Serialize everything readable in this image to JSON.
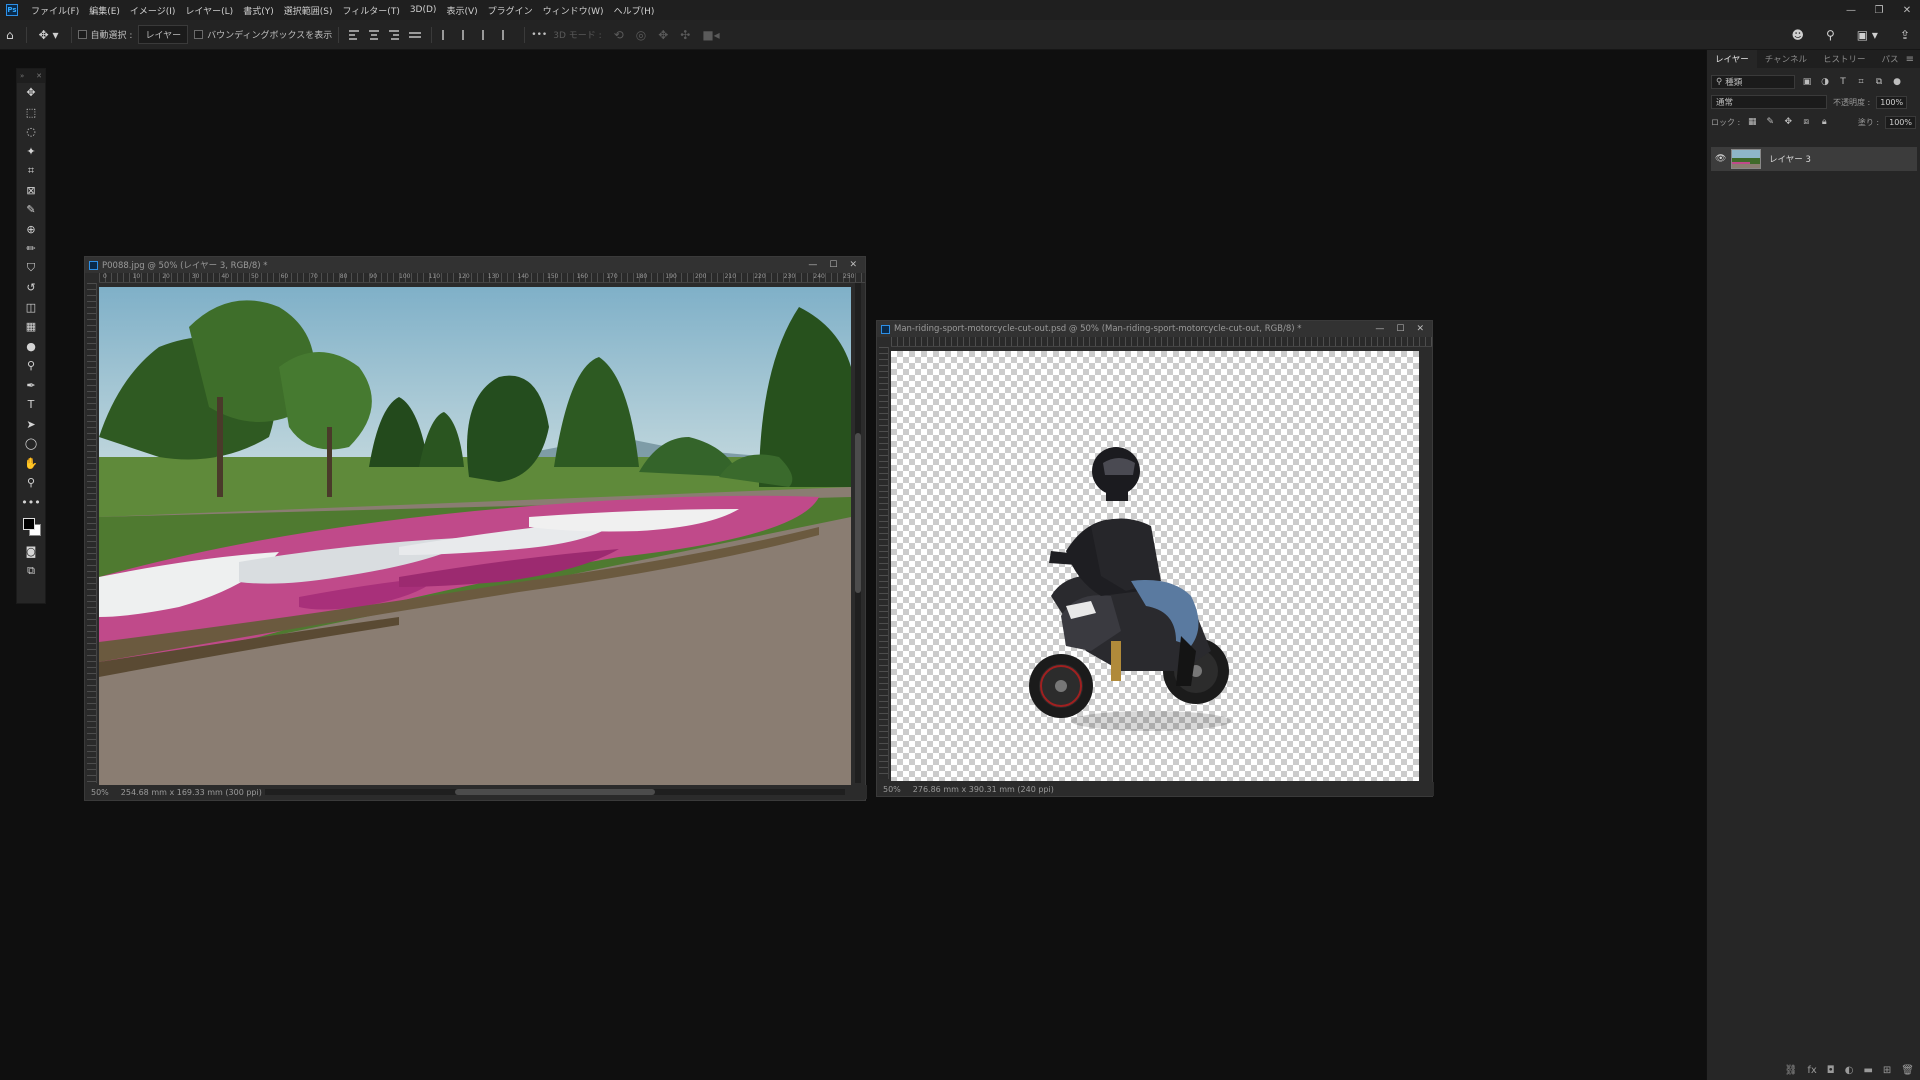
{
  "app": {
    "logo": "Ps"
  },
  "menubar": {
    "items": [
      "ファイル(F)",
      "編集(E)",
      "イメージ(I)",
      "レイヤー(L)",
      "書式(Y)",
      "選択範囲(S)",
      "フィルター(T)",
      "3D(D)",
      "表示(V)",
      "プラグイン",
      "ウィンドウ(W)",
      "ヘルプ(H)"
    ]
  },
  "window_controls": {
    "minimize": "—",
    "restore": "❐",
    "close": "✕"
  },
  "options_bar": {
    "auto_select_label": "自動選択 :",
    "auto_select_target": "レイヤー",
    "show_bounding_box_label": "バウンディングボックスを表示",
    "more": "•••",
    "mode_3d_label": "3D モード :"
  },
  "toolbar": {
    "tools": [
      "move-tool",
      "marquee-tool",
      "lasso-tool",
      "magic-wand-tool",
      "crop-tool",
      "frame-tool",
      "eyedropper-tool",
      "healing-brush-tool",
      "brush-tool",
      "clone-stamp-tool",
      "history-brush-tool",
      "eraser-tool",
      "gradient-tool",
      "blur-tool",
      "dodge-tool",
      "pen-tool",
      "type-tool",
      "path-selection-tool",
      "shape-tool",
      "hand-tool",
      "zoom-tool",
      "edit-toolbar"
    ],
    "glyphs": [
      "✥",
      "⬚",
      "◌",
      "✦",
      "⌗",
      "⊠",
      "✎",
      "⊕",
      "✏",
      "⛉",
      "↺",
      "◫",
      "▦",
      "●",
      "⚲",
      "✒",
      "T",
      "➤",
      "◯",
      "✋",
      "⚲",
      "•••"
    ],
    "foreground_color": "#000000",
    "background_color": "#ffffff"
  },
  "documents": [
    {
      "title": "P0088.jpg @ 50% (レイヤー 3, RGB/8) *",
      "zoom": "50%",
      "info": "254.68 mm x 169.33 mm (300 ppi)",
      "ruler_labels": [
        "0",
        "10",
        "20",
        "30",
        "40",
        "50",
        "60",
        "70",
        "80",
        "90",
        "100",
        "110",
        "120",
        "130",
        "140",
        "150",
        "160",
        "170",
        "180",
        "190",
        "200",
        "210",
        "220",
        "230",
        "240",
        "250"
      ]
    },
    {
      "title": "Man-riding-sport-motorcycle-cut-out.psd @ 50% (Man-riding-sport-motorcycle-cut-out, RGB/8) *",
      "zoom": "50%",
      "info": "276.86 mm x 390.31 mm (240 ppi)"
    }
  ],
  "layers_panel": {
    "tabs": [
      "レイヤー",
      "チャンネル",
      "ヒストリー",
      "パス"
    ],
    "filter_kind": "種類",
    "blend_mode": "通常",
    "opacity_label": "不透明度 :",
    "opacity_value": "100%",
    "lock_label": "ロック :",
    "fill_label": "塗り :",
    "fill_value": "100%",
    "layers": [
      {
        "name": "レイヤー 3",
        "visible": true
      }
    ]
  },
  "colors": {
    "accent": "#31a8ff",
    "app_bg": "#0f0f0f",
    "panel_bg": "#262626"
  }
}
